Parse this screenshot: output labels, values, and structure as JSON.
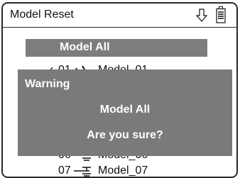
{
  "window": {
    "title": "Model Reset",
    "icons": [
      "down-arrow-icon",
      "battery-icon"
    ]
  },
  "list": {
    "header": "Model All",
    "rows": [
      {
        "check": "✓",
        "number": "01",
        "icon": "airplane-icon",
        "name": "Model_01"
      },
      {
        "check": "",
        "number": "06",
        "icon": "helicopter-icon",
        "name": "Model_06"
      },
      {
        "check": "",
        "number": "07",
        "icon": "helicopter-icon",
        "name": "Model_07"
      }
    ]
  },
  "dialog": {
    "title": "Warning",
    "line1": "Model All",
    "line2": "Are you sure?"
  },
  "colors": {
    "highlight": "#7d7d7d",
    "dialog": "#7a7a7a",
    "border": "#2a2a2a"
  }
}
